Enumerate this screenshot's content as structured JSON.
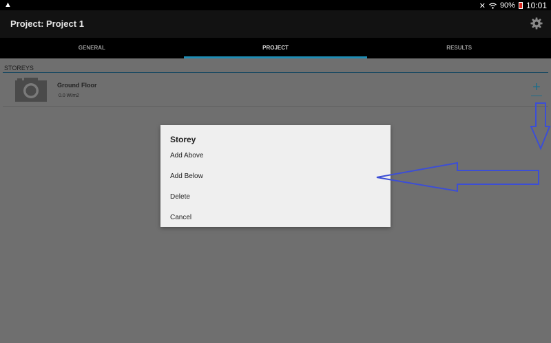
{
  "status_bar": {
    "battery": "90%",
    "time": "10:01"
  },
  "app_bar": {
    "title": "Project: Project 1"
  },
  "tabs": [
    {
      "label": "GENERAL",
      "active": false
    },
    {
      "label": "PROJECT",
      "active": true
    },
    {
      "label": "RESULTS",
      "active": false
    }
  ],
  "storeys": {
    "header": "STOREYS",
    "items": [
      {
        "name": "Ground Floor",
        "value": "0.0 W/m2"
      }
    ]
  },
  "dialog": {
    "title": "Storey",
    "options": [
      "Add Above",
      "Add Below",
      "Delete",
      "Cancel"
    ]
  },
  "colors": {
    "accent": "#1e8cb4",
    "annotation": "#3c4ed6"
  }
}
